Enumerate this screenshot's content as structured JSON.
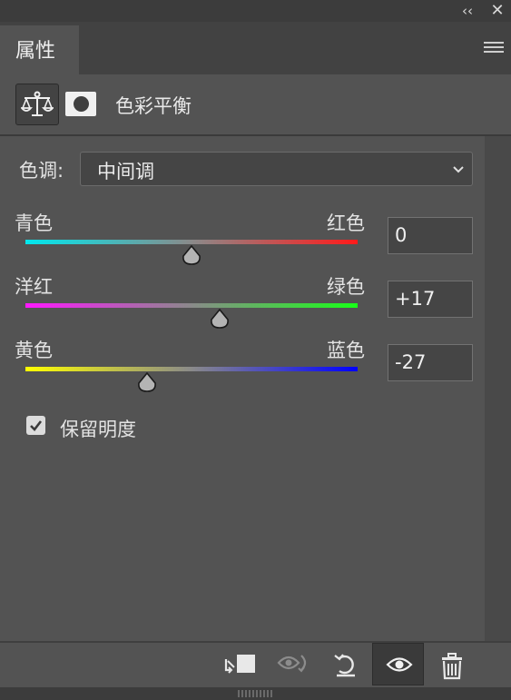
{
  "panel_tab": {
    "label": "属性"
  },
  "adjustment": {
    "title": "色彩平衡"
  },
  "tone": {
    "label": "色调:",
    "selected": "中间调"
  },
  "sliders": [
    {
      "left_label": "青色",
      "right_label": "红色",
      "value": "0",
      "position": 0.5,
      "gradient": [
        "#00e8ee",
        "#ff1a1a"
      ]
    },
    {
      "left_label": "洋红",
      "right_label": "绿色",
      "value": "+17",
      "position": 0.585,
      "gradient": [
        "#ff18ff",
        "#18ff18"
      ]
    },
    {
      "left_label": "黄色",
      "right_label": "蓝色",
      "value": "-27",
      "position": 0.365,
      "gradient": [
        "#ffff00",
        "#0000ff"
      ]
    }
  ],
  "preserve_luminosity": {
    "label": "保留明度",
    "checked": true
  },
  "icons": {
    "collapse": "double-chevron-left-icon",
    "close": "close-icon",
    "menu": "panel-menu-icon",
    "color_balance": "scales-icon",
    "mask": "mask-icon",
    "clip": "clip-to-layer-icon",
    "view_previous": "view-previous-state-icon",
    "reset": "reset-icon",
    "visibility": "eye-icon",
    "delete": "trash-icon"
  }
}
